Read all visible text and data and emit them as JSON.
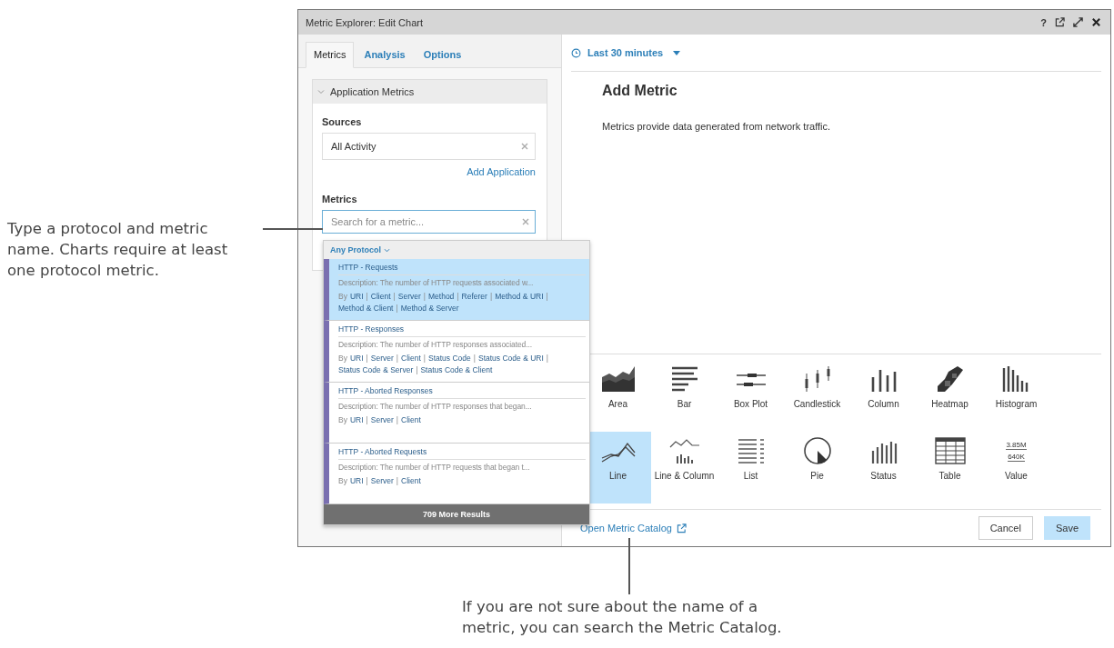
{
  "callouts": [
    {
      "text": "Type a protocol and metric name. Charts require at least one protocol metric."
    },
    {
      "text": "If you are not sure about the name of a metric, you can search the Metric Catalog."
    }
  ],
  "window": {
    "title": "Metric Explorer: Edit Chart",
    "help": "?"
  },
  "tabs": [
    {
      "label": "Metrics",
      "selected": true
    },
    {
      "label": "Analysis",
      "selected": false
    },
    {
      "label": "Options",
      "selected": false
    }
  ],
  "section": {
    "title": "Application Metrics",
    "expanded": true
  },
  "sources": {
    "label": "Sources",
    "value": "All Activity",
    "add_link": "Add Application"
  },
  "metrics": {
    "label": "Metrics",
    "placeholder": "Search for a metric..."
  },
  "dropdown": {
    "filter": "Any Protocol",
    "separator": "|",
    "more": "709 More Results",
    "results": [
      {
        "by_label": "By",
        "title": "HTTP - Requests",
        "description": "Description: The number of HTTP requests associated w...",
        "links": [
          "URI",
          "Client",
          "Server",
          "Method",
          "Referer",
          "Method & URI",
          "Method & Client",
          "Method & Server"
        ],
        "selected": true
      },
      {
        "by_label": "By",
        "title": "HTTP - Responses",
        "description": "Description: The number of HTTP responses associated...",
        "links": [
          "URI",
          "Server",
          "Client",
          "Status Code",
          "Status Code & URI",
          "Status Code & Server",
          "Status Code & Client"
        ],
        "selected": false
      },
      {
        "by_label": "By",
        "title": "HTTP - Aborted Responses",
        "description": "Description: The number of HTTP responses that began...",
        "links": [
          "URI",
          "Server",
          "Client"
        ],
        "selected": false
      },
      {
        "by_label": "By",
        "title": "HTTP - Aborted Requests",
        "description": "Description: The number of HTTP requests that began t...",
        "links": [
          "URI",
          "Server",
          "Client"
        ],
        "selected": false
      }
    ]
  },
  "time_range": "Last 30 minutes",
  "heading": "Add Metric",
  "description": "Metrics provide data generated from network traffic.",
  "chart_types": [
    {
      "kind": "area",
      "label": "Area",
      "selected": false
    },
    {
      "kind": "bar",
      "label": "Bar",
      "selected": false
    },
    {
      "kind": "boxplot",
      "label": "Box Plot",
      "selected": false
    },
    {
      "kind": "candlestick",
      "label": "Candlestick",
      "selected": false
    },
    {
      "kind": "column",
      "label": "Column",
      "selected": false
    },
    {
      "kind": "heatmap",
      "label": "Heatmap",
      "selected": false
    },
    {
      "kind": "histogram",
      "label": "Histogram",
      "selected": false
    },
    {
      "kind": "line",
      "label": "Line",
      "selected": true
    },
    {
      "kind": "linecolumn",
      "label": "Line & Column",
      "selected": false
    },
    {
      "kind": "list",
      "label": "List",
      "selected": false
    },
    {
      "kind": "pie",
      "label": "Pie",
      "selected": false
    },
    {
      "kind": "status",
      "label": "Status",
      "selected": false
    },
    {
      "kind": "table",
      "label": "Table",
      "selected": false
    },
    {
      "kind": "value",
      "label": "Value",
      "selected": false,
      "icon_texts": [
        "3.85M",
        "640K"
      ]
    }
  ],
  "footer": {
    "catalog_link": "Open Metric Catalog",
    "buttons": [
      {
        "label": "Cancel",
        "primary": false
      },
      {
        "label": "Save",
        "primary": true
      }
    ]
  }
}
